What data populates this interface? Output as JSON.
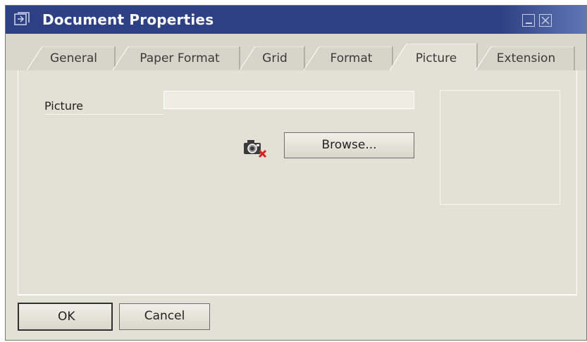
{
  "window": {
    "title": "Document Properties"
  },
  "tabs": [
    {
      "label": "General",
      "active": false
    },
    {
      "label": "Paper Format",
      "active": false
    },
    {
      "label": "Grid",
      "active": false
    },
    {
      "label": "Format",
      "active": false
    },
    {
      "label": "Picture",
      "active": true
    },
    {
      "label": "Extension",
      "active": false
    }
  ],
  "picture": {
    "label": "Picture",
    "value": ""
  },
  "buttons": {
    "browse": "Browse...",
    "ok": "OK",
    "cancel": "Cancel"
  },
  "icons": {
    "window": "document-icon",
    "camera": "camera-remove-icon",
    "minimize": "minimize-icon",
    "close": "close-icon"
  },
  "colors": {
    "titlebar": "#2f3f83",
    "face": "#e2e1d5",
    "accent_red": "#d42020"
  }
}
